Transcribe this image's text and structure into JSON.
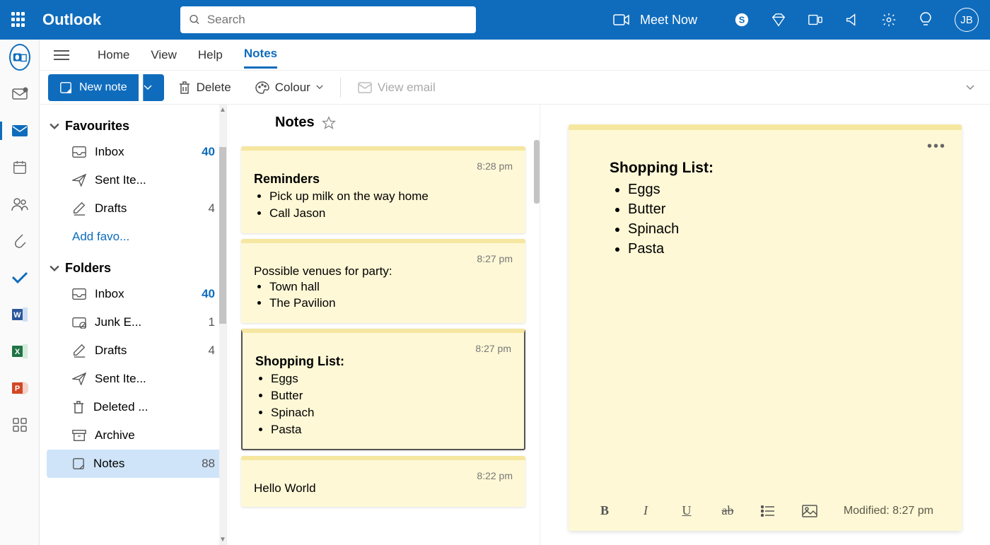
{
  "header": {
    "brand": "Outlook",
    "search_placeholder": "Search",
    "meet_now": "Meet Now",
    "avatar_initials": "JB"
  },
  "tabs": {
    "home": "Home",
    "view": "View",
    "help": "Help",
    "notes": "Notes"
  },
  "toolbar": {
    "new_note": "New note",
    "delete": "Delete",
    "colour": "Colour",
    "view_email": "View email"
  },
  "sidebar": {
    "favourites": "Favourites",
    "folders": "Folders",
    "add_favourite": "Add favo...",
    "fav_items": [
      {
        "label": "Inbox",
        "count": "40",
        "bold": true
      },
      {
        "label": "Sent Ite...",
        "count": ""
      },
      {
        "label": "Drafts",
        "count": "4"
      }
    ],
    "folder_items": [
      {
        "label": "Inbox",
        "count": "40",
        "bold": true
      },
      {
        "label": "Junk E...",
        "count": "1"
      },
      {
        "label": "Drafts",
        "count": "4"
      },
      {
        "label": "Sent Ite...",
        "count": ""
      },
      {
        "label": "Deleted ...",
        "count": ""
      },
      {
        "label": "Archive",
        "count": ""
      },
      {
        "label": "Notes",
        "count": "88",
        "selected": true
      }
    ]
  },
  "notes": {
    "header": "Notes",
    "list": [
      {
        "time": "8:28 pm",
        "title": "Reminders",
        "items": [
          "Pick up milk on the way home",
          "Call Jason"
        ]
      },
      {
        "time": "8:27 pm",
        "title": "",
        "pretext": "Possible venues for party:",
        "items": [
          "Town hall",
          "The Pavilion"
        ]
      },
      {
        "time": "8:27 pm",
        "title": "Shopping List:",
        "items": [
          "Eggs",
          "Butter",
          "Spinach",
          "Pasta"
        ],
        "selected": true
      },
      {
        "time": "8:22 pm",
        "title": "",
        "pretext": "Hello World",
        "items": []
      }
    ]
  },
  "detail": {
    "title": "Shopping List:",
    "items": [
      "Eggs",
      "Butter",
      "Spinach",
      "Pasta"
    ],
    "modified": "Modified: 8:27 pm"
  }
}
